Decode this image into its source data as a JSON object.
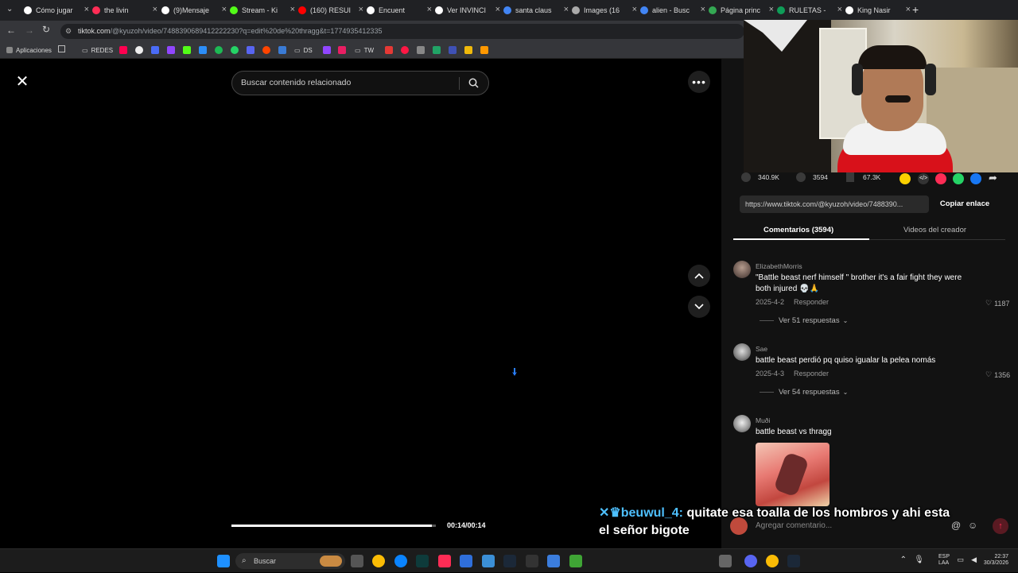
{
  "browser": {
    "tabs": [
      {
        "label": "Cómo jugar",
        "color": "#ffffff"
      },
      {
        "label": "the livin",
        "color": "#ff2d55"
      },
      {
        "label": "(9)Mensaje",
        "color": "#ffffff"
      },
      {
        "label": "Stream - Ki",
        "color": "#53fc18"
      },
      {
        "label": "(160) RESUI",
        "color": "#ff0000"
      },
      {
        "label": "Encuent",
        "color": "#ffffff"
      },
      {
        "label": "Ver INVINCI",
        "color": "#ffffff"
      },
      {
        "label": "santa claus",
        "color": "#4285f4"
      },
      {
        "label": "Images (16",
        "color": "#aaaaaa"
      },
      {
        "label": "alien - Busc",
        "color": "#4285f4"
      },
      {
        "label": "Página princ",
        "color": "#34a853"
      },
      {
        "label": "RULETAS -",
        "color": "#0f9d58"
      },
      {
        "label": "King Nasir",
        "color": "#ffffff"
      }
    ],
    "new_tab": "+",
    "url_domain": "tiktok.com",
    "url_path": "/@kyuzoh/video/7488390689412222230?q=edit%20de%20thragg&t=1774935412335",
    "bookmarks": [
      "Aplicaciones",
      "REDES",
      "DS",
      "TW"
    ]
  },
  "player": {
    "search_placeholder": "Buscar contenido relacionado",
    "timecode": "00:14/00:14",
    "progress_fraction": 0.98
  },
  "stats": {
    "likes": "340.9K",
    "comments": "3594",
    "saves": "67.3K"
  },
  "share": {
    "link": "https://www.tiktok.com/@kyuzoh/video/7488390...",
    "copy_label": "Copiar enlace"
  },
  "panel_tabs": {
    "comments": "Comentarios (3594)",
    "creator_videos": "Videos del creador"
  },
  "comments": [
    {
      "user": "ElizabethMorris",
      "text": "\"Battle beast nerf himself \" brother it's a fair fight they were both injured 💀🙏",
      "date": "2025-4-2",
      "reply": "Responder",
      "likes": "1187",
      "replies": "Ver 51 respuestas"
    },
    {
      "user": "Sae",
      "text": "battle beast perdió pq quiso igualar la pelea nomás",
      "date": "2025-4-3",
      "reply": "Responder",
      "likes": "1356",
      "replies": "Ver 54 respuestas"
    },
    {
      "user": "Muði",
      "text": "battle beast vs thragg"
    }
  ],
  "comment_input_placeholder": "Agregar comentario...",
  "chat_overlay": {
    "user": "beuwul_4:",
    "message_line1": "quitate esa toalla de los hombros y ahi esta",
    "message_line2": "el señor bigote"
  },
  "taskbar": {
    "search_label": "Buscar",
    "lang": "ESP",
    "lang2": "LAA",
    "time": "22:37",
    "date": "30/3/2026"
  }
}
